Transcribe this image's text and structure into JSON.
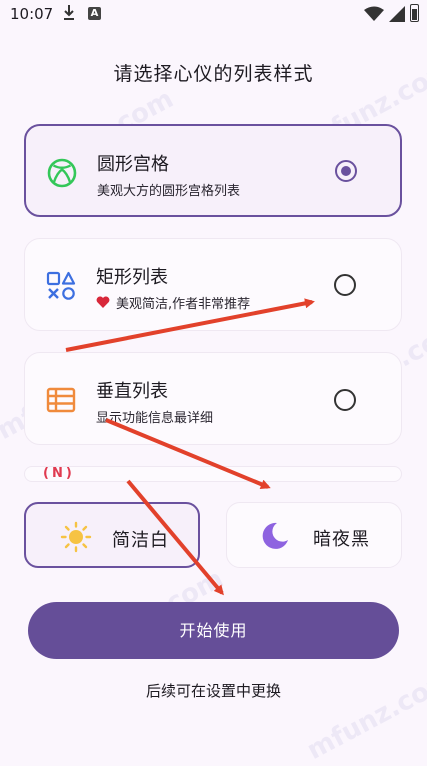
{
  "status_bar": {
    "time": "10:07",
    "icons": [
      "download-icon",
      "a-badge-icon",
      "wifi-icon",
      "signal-icon",
      "battery-icon"
    ],
    "a_badge": "A"
  },
  "title": "请选择心仪的列表样式",
  "styles": [
    {
      "name": "圆形宫格",
      "desc": "美观大方的圆形宫格列表",
      "icon": "xbox-circle-icon",
      "selected": true
    },
    {
      "name": "矩形列表",
      "desc": "美观简洁,作者非常推荐",
      "icon": "shapes-icon",
      "badge_icon": "heart-icon",
      "selected": false
    },
    {
      "name": "垂直列表",
      "desc": "显示功能信息最详细",
      "icon": "table-list-icon",
      "selected": false
    }
  ],
  "n_badge": "(N)",
  "themes": [
    {
      "label": "简洁白",
      "icon": "sun-icon",
      "selected": true
    },
    {
      "label": "暗夜黑",
      "icon": "moon-icon",
      "selected": false
    }
  ],
  "start_button": "开始使用",
  "footer_note": "后续可在设置中更换",
  "watermark_text": "mfunz.com",
  "colors": {
    "accent": "#654E98",
    "background": "#FBF6FD",
    "icon_green": "#34C759",
    "icon_blue": "#3D6FE0",
    "icon_orange": "#F08A3C",
    "annotation_red": "#E2412B"
  }
}
